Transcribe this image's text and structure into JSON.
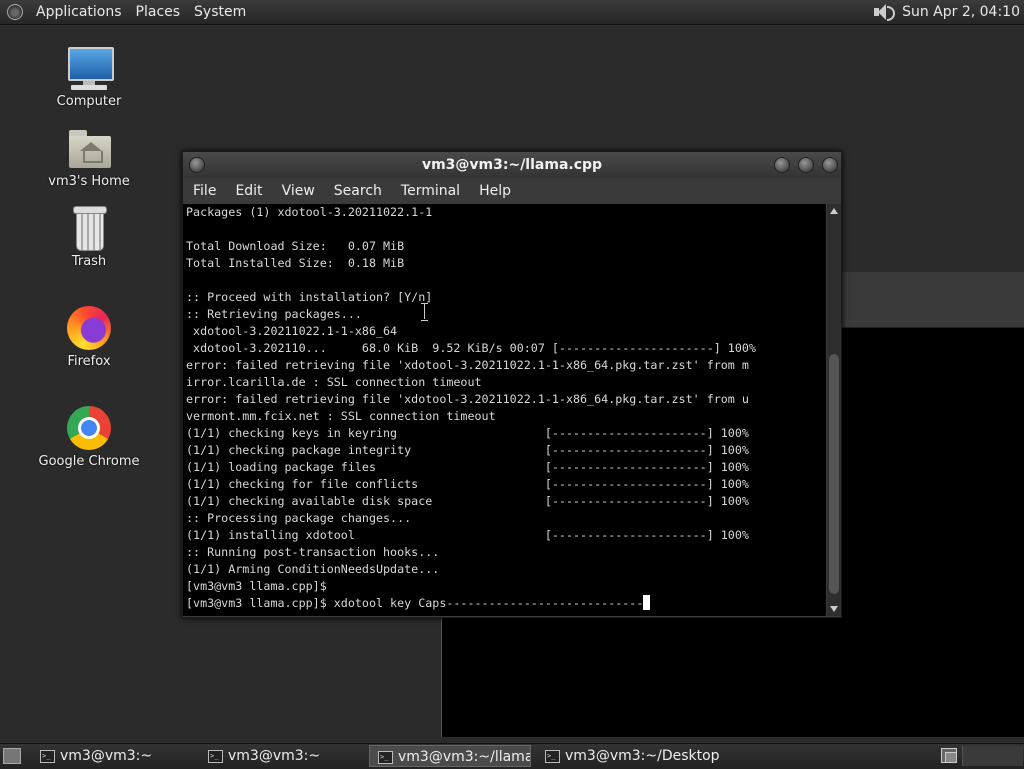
{
  "top_panel": {
    "menus": [
      "Applications",
      "Places",
      "System"
    ],
    "clock": "Sun Apr  2, 04:10"
  },
  "desktop_icons": {
    "computer": "Computer",
    "home": "vm3's Home",
    "trash": "Trash",
    "firefox": "Firefox",
    "chrome": "Google Chrome"
  },
  "terminal": {
    "title": "vm3@vm3:~/llama.cpp",
    "menu": [
      "File",
      "Edit",
      "View",
      "Search",
      "Terminal",
      "Help"
    ],
    "lines": [
      "Packages (1) xdotool-3.20211022.1-1",
      "",
      "Total Download Size:   0.07 MiB",
      "Total Installed Size:  0.18 MiB",
      "",
      ":: Proceed with installation? [Y/n]",
      ":: Retrieving packages...",
      " xdotool-3.20211022.1-1-x86_64",
      " xdotool-3.202110...     68.0 KiB  9.52 KiB/s 00:07 [----------------------] 100%",
      "error: failed retrieving file 'xdotool-3.20211022.1-1-x86_64.pkg.tar.zst' from m",
      "irror.lcarilla.de : SSL connection timeout",
      "error: failed retrieving file 'xdotool-3.20211022.1-1-x86_64.pkg.tar.zst' from u",
      "vermont.mm.fcix.net : SSL connection timeout",
      "(1/1) checking keys in keyring                     [----------------------] 100%",
      "(1/1) checking package integrity                   [----------------------] 100%",
      "(1/1) loading package files                        [----------------------] 100%",
      "(1/1) checking for file conflicts                  [----------------------] 100%",
      "(1/1) checking available disk space                [----------------------] 100%",
      ":: Processing package changes...",
      "(1/1) installing xdotool                           [----------------------] 100%",
      ":: Running post-transaction hooks...",
      "(1/1) Arming ConditionNeedsUpdate...",
      "[vm3@vm3 llama.cpp]$"
    ],
    "prompt_line": "[vm3@vm3 llama.cpp]$ xdotool key Caps----------------------------"
  },
  "taskbar": {
    "tasks": [
      "vm3@vm3:~",
      "vm3@vm3:~",
      "vm3@vm3:~/llama....",
      "vm3@vm3:~/Desktop"
    ]
  }
}
